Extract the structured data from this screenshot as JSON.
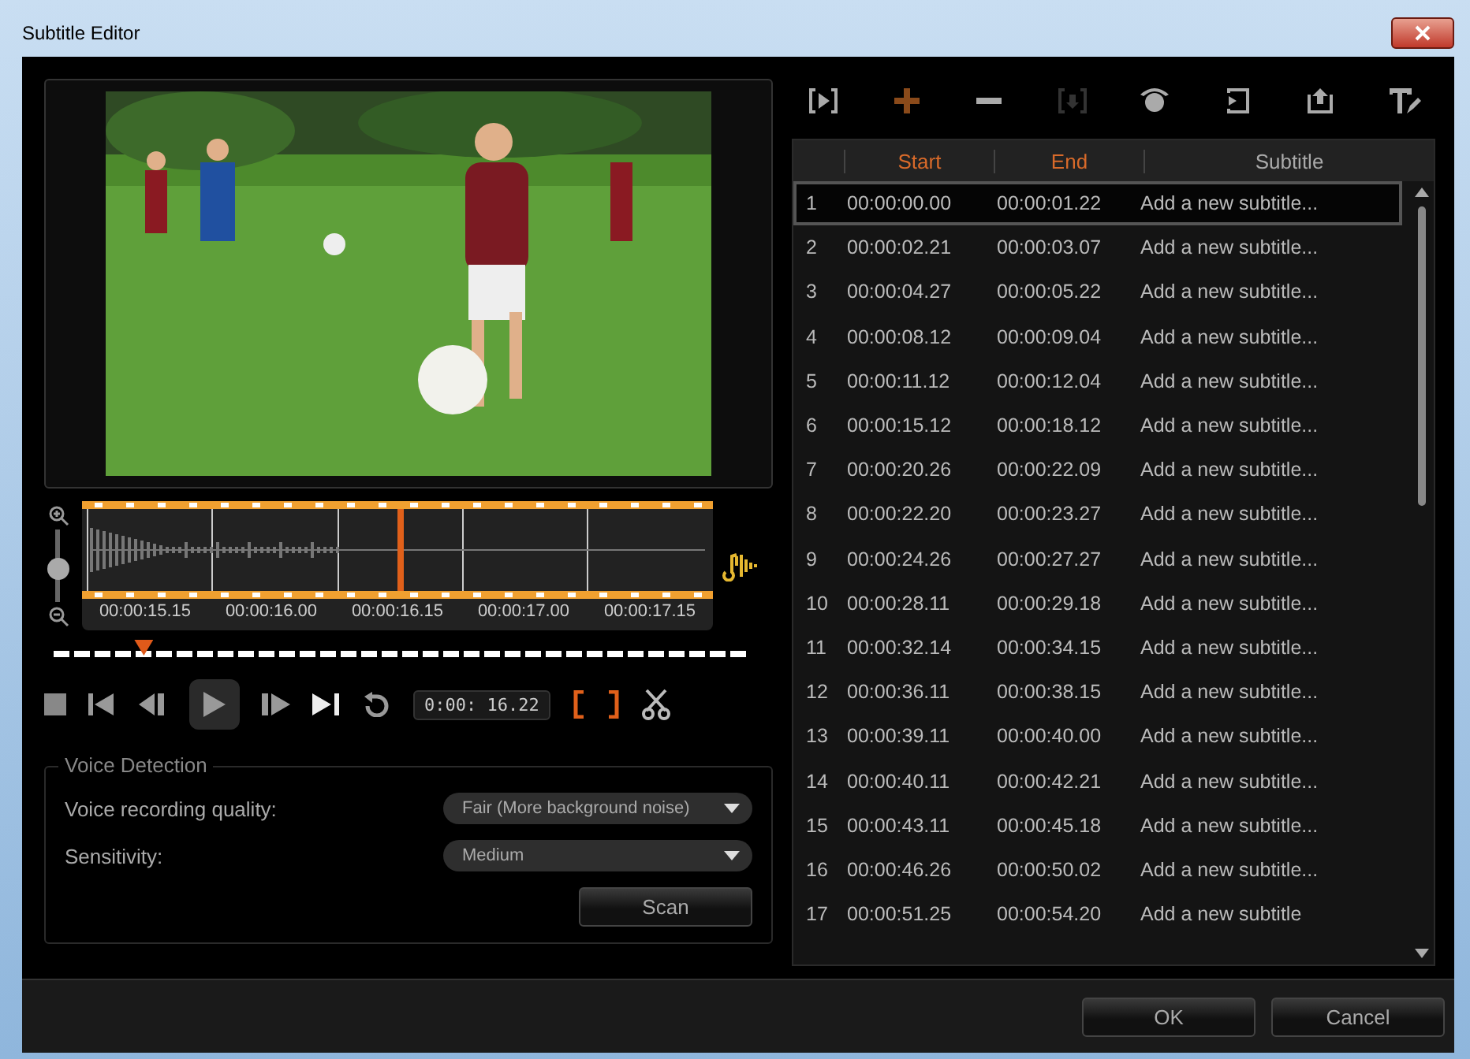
{
  "window": {
    "title": "Subtitle Editor"
  },
  "preview": {
    "kind": "picture"
  },
  "zoom_slider": {
    "level": 0.45
  },
  "waveform": {
    "ticks": [
      "00:00:15.15",
      "00:00:16.00",
      "00:00:16.15",
      "00:00:17.00",
      "00:00:17.15"
    ]
  },
  "scrubber": {
    "level": 0.13
  },
  "transport": {
    "timecode": "0:00: 16.22"
  },
  "toolbar": [
    {
      "disabled": false
    },
    {
      "disabled": false
    },
    {
      "disabled": false
    },
    {
      "disabled": true
    },
    {
      "disabled": false
    },
    {
      "disabled": false
    },
    {
      "disabled": false
    },
    {
      "disabled": false
    }
  ],
  "voice_detection": {
    "title": "Voice Detection",
    "fields": [
      {
        "label": "Voice recording quality:",
        "value": "Fair (More background noise)"
      },
      {
        "label": "Sensitivity:",
        "value": "Medium"
      }
    ],
    "scan": "Scan"
  },
  "table": {
    "columns": [
      "Start",
      "End",
      "Subtitle"
    ],
    "rows": [
      {
        "n": "1",
        "start": "00:00:00.00",
        "end": "00:00:01.22",
        "text": "Add a new subtitle...",
        "selected": true
      },
      {
        "n": "2",
        "start": "00:00:02.21",
        "end": "00:00:03.07",
        "text": "Add a new subtitle...",
        "selected": false
      },
      {
        "n": "3",
        "start": "00:00:04.27",
        "end": "00:00:05.22",
        "text": "Add a new subtitle...",
        "selected": false
      },
      {
        "n": "4",
        "start": "00:00:08.12",
        "end": "00:00:09.04",
        "text": "Add a new subtitle...",
        "selected": false
      },
      {
        "n": "5",
        "start": "00:00:11.12",
        "end": "00:00:12.04",
        "text": "Add a new subtitle...",
        "selected": false
      },
      {
        "n": "6",
        "start": "00:00:15.12",
        "end": "00:00:18.12",
        "text": "Add a new subtitle...",
        "selected": false
      },
      {
        "n": "7",
        "start": "00:00:20.26",
        "end": "00:00:22.09",
        "text": "Add a new subtitle...",
        "selected": false
      },
      {
        "n": "8",
        "start": "00:00:22.20",
        "end": "00:00:23.27",
        "text": "Add a new subtitle...",
        "selected": false
      },
      {
        "n": "9",
        "start": "00:00:24.26",
        "end": "00:00:27.27",
        "text": "Add a new subtitle...",
        "selected": false
      },
      {
        "n": "10",
        "start": "00:00:28.11",
        "end": "00:00:29.18",
        "text": "Add a new subtitle...",
        "selected": false
      },
      {
        "n": "11",
        "start": "00:00:32.14",
        "end": "00:00:34.15",
        "text": "Add a new subtitle...",
        "selected": false
      },
      {
        "n": "12",
        "start": "00:00:36.11",
        "end": "00:00:38.15",
        "text": "Add a new subtitle...",
        "selected": false
      },
      {
        "n": "13",
        "start": "00:00:39.11",
        "end": "00:00:40.00",
        "text": "Add a new subtitle...",
        "selected": false
      },
      {
        "n": "14",
        "start": "00:00:40.11",
        "end": "00:00:42.21",
        "text": "Add a new subtitle...",
        "selected": false
      },
      {
        "n": "15",
        "start": "00:00:43.11",
        "end": "00:00:45.18",
        "text": "Add a new subtitle...",
        "selected": false
      },
      {
        "n": "16",
        "start": "00:00:46.26",
        "end": "00:00:50.02",
        "text": "Add a new subtitle...",
        "selected": false
      },
      {
        "n": "17",
        "start": "00:00:51.25",
        "end": "00:00:54.20",
        "text": "Add a new subtitle",
        "selected": false
      }
    ]
  },
  "buttons": [
    "OK",
    "Cancel"
  ]
}
